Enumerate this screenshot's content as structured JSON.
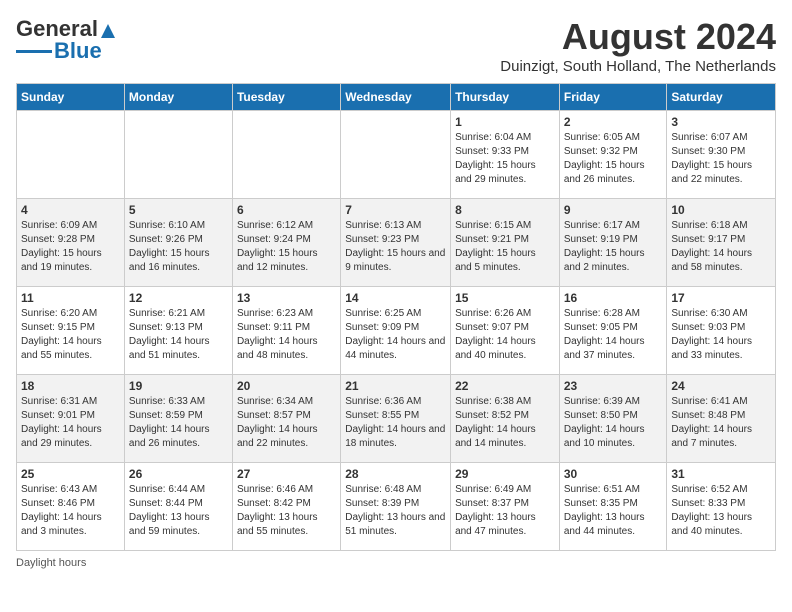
{
  "header": {
    "logo_general": "General",
    "logo_blue": "Blue",
    "month_year": "August 2024",
    "location": "Duinzigt, South Holland, The Netherlands"
  },
  "weekdays": [
    "Sunday",
    "Monday",
    "Tuesday",
    "Wednesday",
    "Thursday",
    "Friday",
    "Saturday"
  ],
  "weeks": [
    [
      {
        "day": "",
        "info": ""
      },
      {
        "day": "",
        "info": ""
      },
      {
        "day": "",
        "info": ""
      },
      {
        "day": "",
        "info": ""
      },
      {
        "day": "1",
        "info": "Sunrise: 6:04 AM\nSunset: 9:33 PM\nDaylight: 15 hours and 29 minutes."
      },
      {
        "day": "2",
        "info": "Sunrise: 6:05 AM\nSunset: 9:32 PM\nDaylight: 15 hours and 26 minutes."
      },
      {
        "day": "3",
        "info": "Sunrise: 6:07 AM\nSunset: 9:30 PM\nDaylight: 15 hours and 22 minutes."
      }
    ],
    [
      {
        "day": "4",
        "info": "Sunrise: 6:09 AM\nSunset: 9:28 PM\nDaylight: 15 hours and 19 minutes."
      },
      {
        "day": "5",
        "info": "Sunrise: 6:10 AM\nSunset: 9:26 PM\nDaylight: 15 hours and 16 minutes."
      },
      {
        "day": "6",
        "info": "Sunrise: 6:12 AM\nSunset: 9:24 PM\nDaylight: 15 hours and 12 minutes."
      },
      {
        "day": "7",
        "info": "Sunrise: 6:13 AM\nSunset: 9:23 PM\nDaylight: 15 hours and 9 minutes."
      },
      {
        "day": "8",
        "info": "Sunrise: 6:15 AM\nSunset: 9:21 PM\nDaylight: 15 hours and 5 minutes."
      },
      {
        "day": "9",
        "info": "Sunrise: 6:17 AM\nSunset: 9:19 PM\nDaylight: 15 hours and 2 minutes."
      },
      {
        "day": "10",
        "info": "Sunrise: 6:18 AM\nSunset: 9:17 PM\nDaylight: 14 hours and 58 minutes."
      }
    ],
    [
      {
        "day": "11",
        "info": "Sunrise: 6:20 AM\nSunset: 9:15 PM\nDaylight: 14 hours and 55 minutes."
      },
      {
        "day": "12",
        "info": "Sunrise: 6:21 AM\nSunset: 9:13 PM\nDaylight: 14 hours and 51 minutes."
      },
      {
        "day": "13",
        "info": "Sunrise: 6:23 AM\nSunset: 9:11 PM\nDaylight: 14 hours and 48 minutes."
      },
      {
        "day": "14",
        "info": "Sunrise: 6:25 AM\nSunset: 9:09 PM\nDaylight: 14 hours and 44 minutes."
      },
      {
        "day": "15",
        "info": "Sunrise: 6:26 AM\nSunset: 9:07 PM\nDaylight: 14 hours and 40 minutes."
      },
      {
        "day": "16",
        "info": "Sunrise: 6:28 AM\nSunset: 9:05 PM\nDaylight: 14 hours and 37 minutes."
      },
      {
        "day": "17",
        "info": "Sunrise: 6:30 AM\nSunset: 9:03 PM\nDaylight: 14 hours and 33 minutes."
      }
    ],
    [
      {
        "day": "18",
        "info": "Sunrise: 6:31 AM\nSunset: 9:01 PM\nDaylight: 14 hours and 29 minutes."
      },
      {
        "day": "19",
        "info": "Sunrise: 6:33 AM\nSunset: 8:59 PM\nDaylight: 14 hours and 26 minutes."
      },
      {
        "day": "20",
        "info": "Sunrise: 6:34 AM\nSunset: 8:57 PM\nDaylight: 14 hours and 22 minutes."
      },
      {
        "day": "21",
        "info": "Sunrise: 6:36 AM\nSunset: 8:55 PM\nDaylight: 14 hours and 18 minutes."
      },
      {
        "day": "22",
        "info": "Sunrise: 6:38 AM\nSunset: 8:52 PM\nDaylight: 14 hours and 14 minutes."
      },
      {
        "day": "23",
        "info": "Sunrise: 6:39 AM\nSunset: 8:50 PM\nDaylight: 14 hours and 10 minutes."
      },
      {
        "day": "24",
        "info": "Sunrise: 6:41 AM\nSunset: 8:48 PM\nDaylight: 14 hours and 7 minutes."
      }
    ],
    [
      {
        "day": "25",
        "info": "Sunrise: 6:43 AM\nSunset: 8:46 PM\nDaylight: 14 hours and 3 minutes."
      },
      {
        "day": "26",
        "info": "Sunrise: 6:44 AM\nSunset: 8:44 PM\nDaylight: 13 hours and 59 minutes."
      },
      {
        "day": "27",
        "info": "Sunrise: 6:46 AM\nSunset: 8:42 PM\nDaylight: 13 hours and 55 minutes."
      },
      {
        "day": "28",
        "info": "Sunrise: 6:48 AM\nSunset: 8:39 PM\nDaylight: 13 hours and 51 minutes."
      },
      {
        "day": "29",
        "info": "Sunrise: 6:49 AM\nSunset: 8:37 PM\nDaylight: 13 hours and 47 minutes."
      },
      {
        "day": "30",
        "info": "Sunrise: 6:51 AM\nSunset: 8:35 PM\nDaylight: 13 hours and 44 minutes."
      },
      {
        "day": "31",
        "info": "Sunrise: 6:52 AM\nSunset: 8:33 PM\nDaylight: 13 hours and 40 minutes."
      }
    ]
  ],
  "footer": "Daylight hours"
}
